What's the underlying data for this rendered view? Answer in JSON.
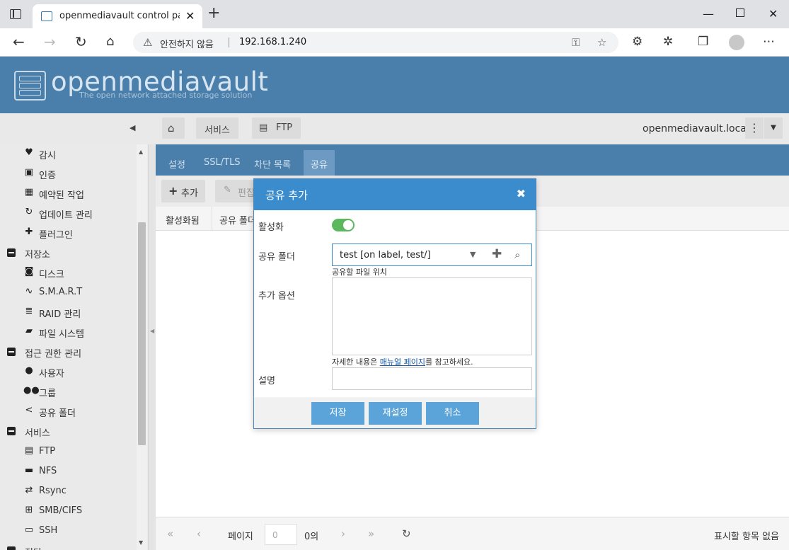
{
  "browser": {
    "tab_title": "openmediavault control panel - c",
    "security_label": "안전하지 않음",
    "url": "192.168.1.240"
  },
  "app": {
    "logo_text": "openmediavault",
    "logo_subtitle": "The open network attached storage solution",
    "hostname": "openmediavault.local"
  },
  "breadcrumb": {
    "home_icon": "home-icon",
    "items": [
      "서비스",
      "FTP"
    ]
  },
  "sidebar": {
    "items": [
      {
        "label": "감시",
        "icon": "heart-pulse-icon",
        "type": "item"
      },
      {
        "label": "인증",
        "icon": "certificate-icon",
        "type": "item"
      },
      {
        "label": "예약된 작업",
        "icon": "calendar-clock-icon",
        "type": "item"
      },
      {
        "label": "업데이트 관리",
        "icon": "refresh-icon",
        "type": "item"
      },
      {
        "label": "플러그인",
        "icon": "puzzle-icon",
        "type": "item"
      },
      {
        "label": "저장소",
        "icon": "minus-square-icon",
        "type": "group"
      },
      {
        "label": "디스크",
        "icon": "disk-icon",
        "type": "item"
      },
      {
        "label": "S.M.A.R.T",
        "icon": "pulse-icon",
        "type": "item"
      },
      {
        "label": "RAID 관리",
        "icon": "database-icon",
        "type": "item"
      },
      {
        "label": "파일 시스템",
        "icon": "folder-icon",
        "type": "item"
      },
      {
        "label": "접근 권한 관리",
        "icon": "minus-square-icon",
        "type": "group"
      },
      {
        "label": "사용자",
        "icon": "user-icon",
        "type": "item"
      },
      {
        "label": "그룹",
        "icon": "users-icon",
        "type": "item"
      },
      {
        "label": "공유 폴더",
        "icon": "share-icon",
        "type": "item"
      },
      {
        "label": "서비스",
        "icon": "minus-square-icon",
        "type": "group"
      },
      {
        "label": "FTP",
        "icon": "server-icon",
        "type": "item"
      },
      {
        "label": "NFS",
        "icon": "monitor-icon",
        "type": "item"
      },
      {
        "label": "Rsync",
        "icon": "sync-icon",
        "type": "item"
      },
      {
        "label": "SMB/CIFS",
        "icon": "windows-icon",
        "type": "item"
      },
      {
        "label": "SSH",
        "icon": "terminal-icon",
        "type": "item"
      },
      {
        "label": "진단",
        "icon": "minus-square-icon",
        "type": "group"
      }
    ]
  },
  "main": {
    "tabs": [
      {
        "label": "설정",
        "active": false
      },
      {
        "label": "SSL/TLS",
        "active": false
      },
      {
        "label": "차단 목록",
        "active": false
      },
      {
        "label": "공유",
        "active": true
      }
    ],
    "actions": {
      "add": "추가",
      "edit": "편집"
    },
    "columns": [
      "활성화됨",
      "공유 폴더"
    ],
    "pager": {
      "page_label": "페이지",
      "page_value": "0",
      "of_label": "0의",
      "empty_text": "표시할 항목 없음"
    }
  },
  "modal": {
    "title": "공유 추가",
    "enable_label": "활성화",
    "enabled": true,
    "shared_folder_label": "공유 폴더",
    "shared_folder_value": "test [on label, test/]",
    "shared_folder_hint": "공유할 파일 위치",
    "extra_options_label": "추가 옵션",
    "extra_options_value": "",
    "hint_prefix": "자세한 내용은 ",
    "hint_link": "매뉴얼 페이지",
    "hint_suffix": "를 참고하세요.",
    "comment_label": "설명",
    "comment_value": "",
    "buttons": {
      "save": "저장",
      "reset": "재설정",
      "cancel": "취소"
    }
  },
  "colors": {
    "header_blue": "#4a7eab",
    "modal_header": "#3b8ccc",
    "button_blue": "#5ba4d9",
    "toggle_green": "#5cb85c"
  }
}
